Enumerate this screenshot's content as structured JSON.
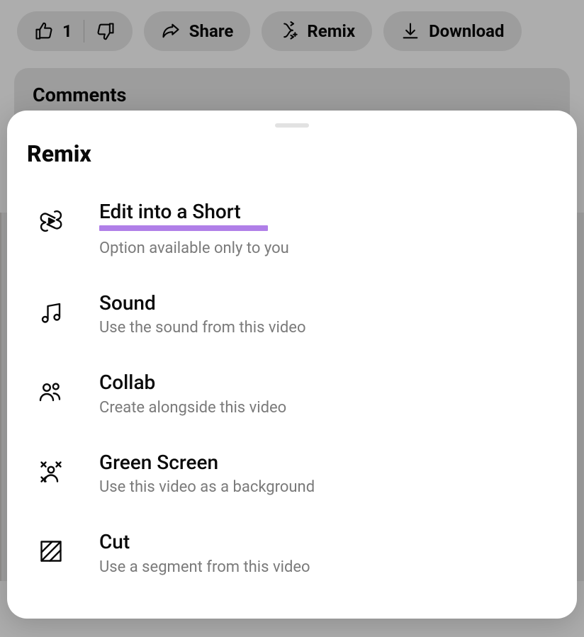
{
  "actions": {
    "like_count": "1",
    "share": "Share",
    "remix": "Remix",
    "download": "Download"
  },
  "comments": {
    "title": "Comments"
  },
  "sheet": {
    "title": "Remix",
    "items": [
      {
        "title": "Edit into a Short",
        "subtitle": "Option available only to you",
        "highlighted": true
      },
      {
        "title": "Sound",
        "subtitle": "Use the sound from this video"
      },
      {
        "title": "Collab",
        "subtitle": "Create alongside this video"
      },
      {
        "title": "Green Screen",
        "subtitle": "Use this video as a background"
      },
      {
        "title": "Cut",
        "subtitle": "Use a segment from this video"
      }
    ]
  }
}
